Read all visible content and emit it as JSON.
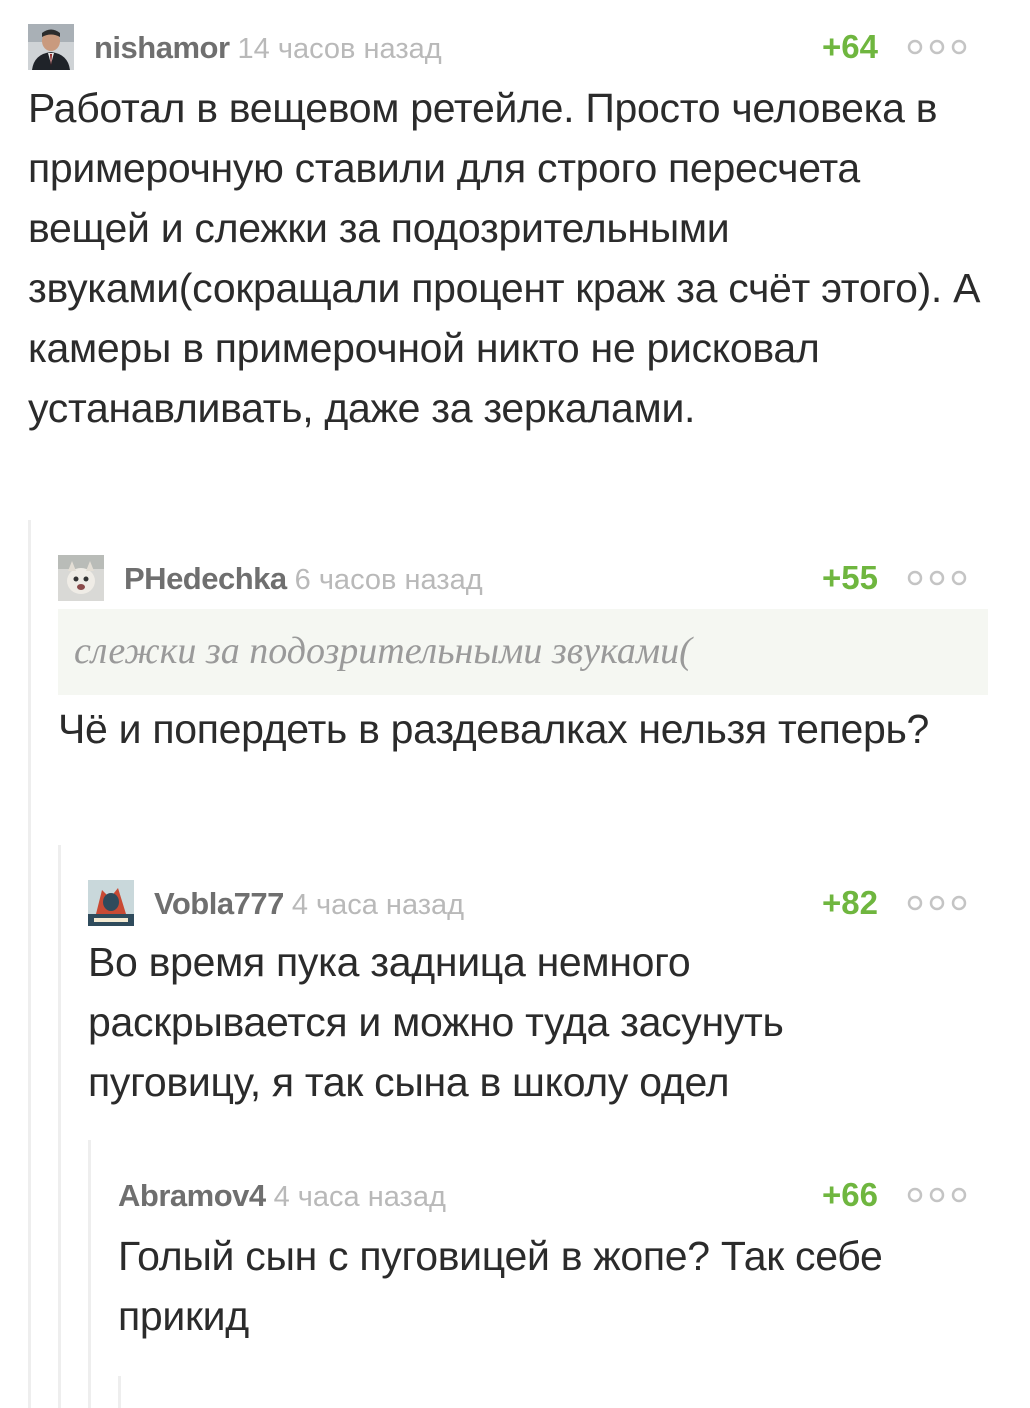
{
  "comments": [
    {
      "author": "nishamor",
      "time": "14 часов назад",
      "rating": "+64",
      "text": "Работал в вещевом ретейле. Просто человека в примерочную ставили для строго пересчета вещей и слежки за подозрительными звуками(сокращали процент краж за счёт этого). А камеры в примерочной никто не рисковал устанавливать, даже за зеркалами."
    },
    {
      "author": "PHedechka",
      "time": "6 часов назад",
      "rating": "+55",
      "quote": "слежки за подозрительными звуками(",
      "text": "Чё и попердеть в раздевалках нельзя теперь?"
    },
    {
      "author": "Vobla777",
      "time": "4 часа назад",
      "rating": "+82",
      "text": "Во время пука задница немного раскрывается и можно туда засунуть пуговицу, я так сына в школу одел"
    },
    {
      "author": "Abramov4",
      "time": "4 часа назад",
      "rating": "+66",
      "text": "Голый сын с пуговицей в жопе? Так себе прикид"
    }
  ],
  "icons": {
    "more": "more-dots-icon",
    "avatar": "avatar-image"
  },
  "colors": {
    "rating": "#6fb63f",
    "author": "#6f6f6f",
    "time": "#b9b9b9",
    "quote_bg": "#f5f7f2",
    "thread_line": "#eeeeee"
  }
}
